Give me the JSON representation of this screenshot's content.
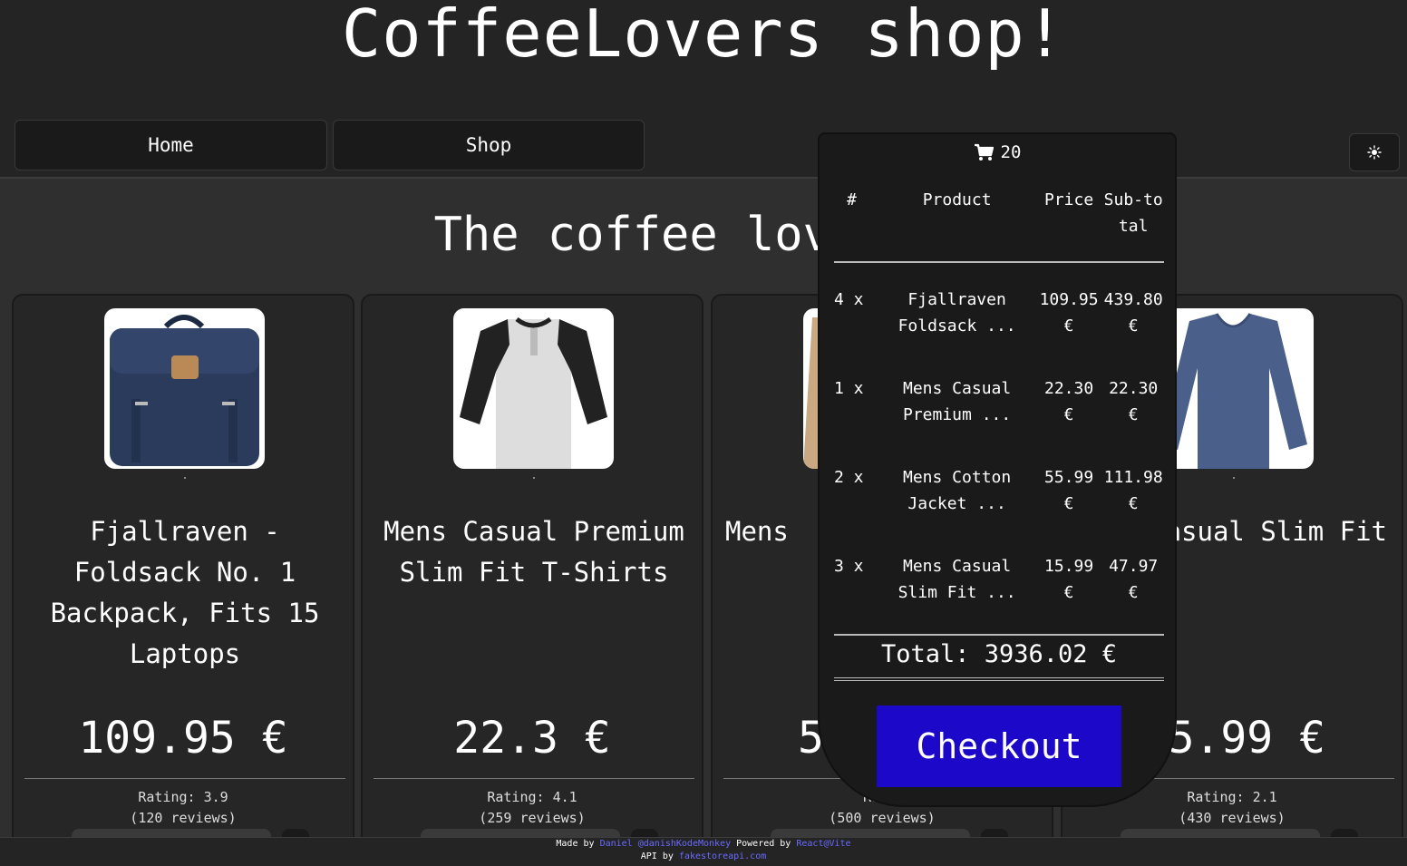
{
  "header": {
    "title": "CoffeeLovers shop!"
  },
  "nav": {
    "home": "Home",
    "shop": "Shop",
    "theme_icon": "sun-icon"
  },
  "main": {
    "headline": "The coffee lovers m"
  },
  "products": [
    {
      "title": "Fjallraven - Foldsack No. 1 Backpack, Fits 15 Laptops",
      "price": "109.95 €",
      "rating": "Rating: 3.9",
      "reviews": "(120 reviews)"
    },
    {
      "title": "Mens Casual Premium Slim Fit T-Shirts",
      "price": "22.3 €",
      "rating": "Rating: 4.1",
      "reviews": "(259 reviews)"
    },
    {
      "title": "Mens",
      "price": "55",
      "rating": "Ra",
      "reviews": "(500 reviews)"
    },
    {
      "title": "asual Slim Fit",
      "price": "5.99 €",
      "rating": "Rating: 2.1",
      "reviews": "(430 reviews)"
    }
  ],
  "cart": {
    "count": "20",
    "icon": "cart-icon",
    "headers": {
      "num": "#",
      "product": "Product",
      "price": "Price",
      "subtotal": "Sub-total"
    },
    "items": [
      {
        "qty": "4 x",
        "name": "Fjallraven Foldsack ...",
        "price": "109.95 €",
        "subtotal": "439.80 €"
      },
      {
        "qty": "1 x",
        "name": "Mens Casual Premium ...",
        "price": "22.30 €",
        "subtotal": "22.30 €"
      },
      {
        "qty": "2 x",
        "name": "Mens Cotton Jacket ...",
        "price": "55.99 €",
        "subtotal": "111.98 €"
      },
      {
        "qty": "3 x",
        "name": "Mens Casual Slim Fit ...",
        "price": "15.99 €",
        "subtotal": "47.97 €"
      }
    ],
    "total": "Total: 3936.02 €",
    "checkout": "Checkout"
  },
  "footer": {
    "made_by": "Made by",
    "author": "Daniel",
    "handle": "@danishKodeMonkey",
    "powered_by": "Powered by",
    "stack": "React@Vite",
    "api_by": "API by",
    "api": "fakestoreapi.com"
  },
  "colors": {
    "background": "#242424",
    "checkout": "#1c08c9",
    "link": "#6a6aff"
  }
}
